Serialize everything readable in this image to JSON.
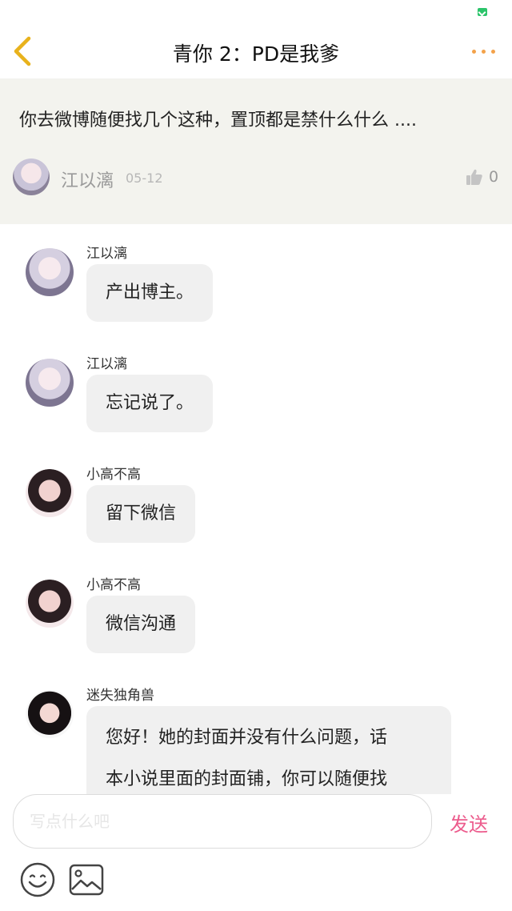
{
  "nav": {
    "title": "青你 2：PD是我爹",
    "back_icon": "chevron-left-icon",
    "more_icon": "more-dots-icon",
    "accent_color": "#f3a24a"
  },
  "post": {
    "text": "你去微博随便找几个这种，置顶都是禁什么什么 ....",
    "author": "江以漓",
    "date": "05-12",
    "like_count": "0"
  },
  "messages": [
    {
      "name": "江以漓",
      "text": "产出博主。"
    },
    {
      "name": "江以漓",
      "text": "忘记说了。"
    },
    {
      "name": "小高不高",
      "text": "留下微信"
    },
    {
      "name": "小高不高",
      "text": "微信沟通"
    },
    {
      "name": "迷失独角兽",
      "lines": [
        "您好！她的封面并没有什么问题，话",
        "本小说里面的封面铺，你可以随便找"
      ]
    }
  ],
  "input": {
    "placeholder": "写点什么吧",
    "send_label": "发送",
    "send_color": "#ec5c8d"
  }
}
